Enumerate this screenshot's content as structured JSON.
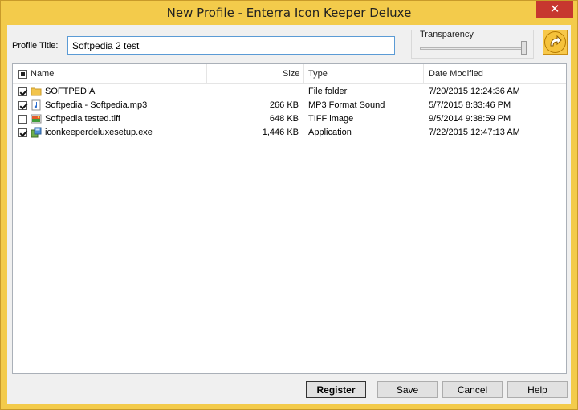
{
  "window": {
    "title": "New Profile - Enterra Icon Keeper Deluxe",
    "close_glyph": "✕"
  },
  "profile": {
    "label": "Profile Title:",
    "value": "Softpedia 2 test"
  },
  "transparency": {
    "label": "Transparency",
    "level": 1.0
  },
  "columns": {
    "name": "Name",
    "size": "Size",
    "type": "Type",
    "date": "Date Modified"
  },
  "files": [
    {
      "checked": true,
      "icon": "folder-icon",
      "name": "SOFTPEDIA",
      "size": "",
      "type": "File folder",
      "date": "7/20/2015 12:24:36 AM"
    },
    {
      "checked": true,
      "icon": "audio-file-icon",
      "name": "Softpedia - Softpedia.mp3",
      "size": "266 KB",
      "type": "MP3 Format Sound",
      "date": "5/7/2015 8:33:46 PM"
    },
    {
      "checked": false,
      "icon": "image-file-icon",
      "name": "Softpedia tested.tiff",
      "size": "648 KB",
      "type": "TIFF image",
      "date": "9/5/2014 9:38:59 PM"
    },
    {
      "checked": true,
      "icon": "setup-exe-icon",
      "name": "iconkeeperdeluxesetup.exe",
      "size": "1,446 KB",
      "type": "Application",
      "date": "7/22/2015 12:47:13 AM"
    }
  ],
  "buttons": {
    "register": "Register",
    "save": "Save",
    "cancel": "Cancel",
    "help": "Help"
  },
  "colors": {
    "title_bar": "#f3cb4b",
    "close": "#c7372f",
    "input_border": "#5b9bd5"
  }
}
